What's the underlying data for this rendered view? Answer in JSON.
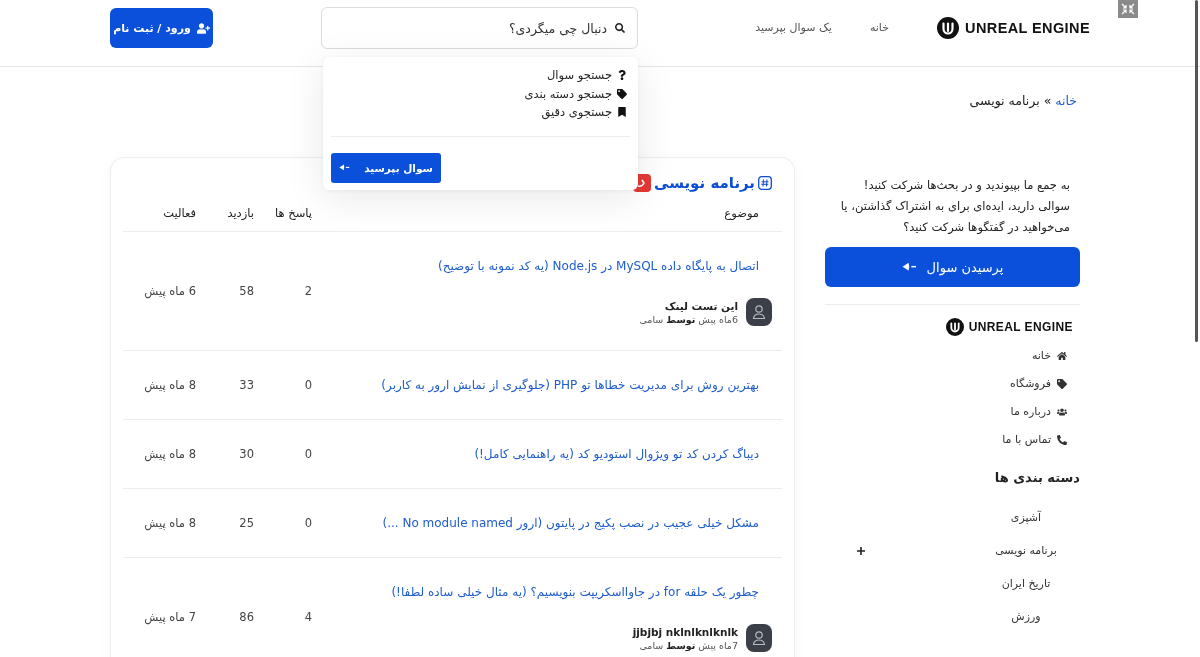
{
  "header": {
    "logo": "UNREAL ENGINE",
    "nav": [
      {
        "label": "خانه"
      },
      {
        "label": "یک سوال بپرسید"
      }
    ],
    "search": {
      "placeholder": "دنبال چی میگردی؟"
    },
    "login_button": "ورود / ثبت نام"
  },
  "search_menu": {
    "items": [
      {
        "kind": "question",
        "label": "جستجو سوال"
      },
      {
        "kind": "tag",
        "label": "جستجو دسته بندی"
      },
      {
        "kind": "bookmark",
        "label": "جستجوی دقیق"
      }
    ],
    "button": "سوال بپرسید"
  },
  "breadcrumb": {
    "items": [
      {
        "kind": "link",
        "label": "خانه"
      },
      {
        "kind": "current",
        "label": "برنامه نویسی"
      }
    ],
    "separator": "»"
  },
  "topics": {
    "title": "برنامه نویسی",
    "columns": [
      "موضوع",
      "پاسخ ها",
      "بازدید",
      "فعالیت"
    ],
    "rows": [
      {
        "title": "اتصال به پایگاه داده MySQL در Node.js (یه کد نمونه با توضیح)",
        "answers": "2",
        "views": "58",
        "activity": "6 ماه پیش",
        "author": {
          "name": "این تست لینک",
          "meta": "6ماه پیش **توسط** سامی"
        }
      },
      {
        "title": "بهترین روش برای مدیریت خطاها تو PHP (جلوگیری از نمایش ارور به کاربر)",
        "answers": "0",
        "views": "33",
        "activity": "8 ماه پیش"
      },
      {
        "title": "دیباگ کردن کد تو ویژوال استودیو کد (یه راهنمایی کامل!)",
        "answers": "0",
        "views": "30",
        "activity": "8 ماه پیش"
      },
      {
        "title": "مشکل خیلی عجیب در نصب پکیج در پایتون (ارور No module named ...)",
        "answers": "0",
        "views": "25",
        "activity": "8 ماه پیش"
      },
      {
        "title": "چطور یک حلقه for در جاوااسکریپت بنویسیم؟ (یه مثال خیلی ساده لطفا!)",
        "answers": "4",
        "views": "86",
        "activity": "7 ماه پیش",
        "author": {
          "name": "jjbjbj nklnlknlknlk",
          "meta": "7ماه پیش **توسط** سامی"
        }
      }
    ]
  },
  "sidebar": {
    "intro": "به جمع ما بپیوندید و در بحث‌ها شرکت کنید! سوالی دارید، ایده‌ای برای به اشتراک گذاشتن، یا می‌خواهید در گفتگوها شرکت کنید؟",
    "button": "پرسیدن سوال",
    "logo": "UNREAL ENGINE",
    "links": [
      {
        "kind": "home",
        "label": "خانه"
      },
      {
        "kind": "shop",
        "label": "فروشگاه"
      },
      {
        "kind": "about",
        "label": "درباره ما"
      },
      {
        "kind": "contact",
        "label": "تماس با ما"
      }
    ],
    "categories_title": "دسته بندی ها",
    "categories": [
      {
        "label": "آشپزی",
        "expandable": false
      },
      {
        "label": "برنامه نویسی",
        "expandable": true
      },
      {
        "label": "تاریخ ایران",
        "expandable": false
      },
      {
        "label": "ورزش",
        "expandable": false
      }
    ]
  }
}
